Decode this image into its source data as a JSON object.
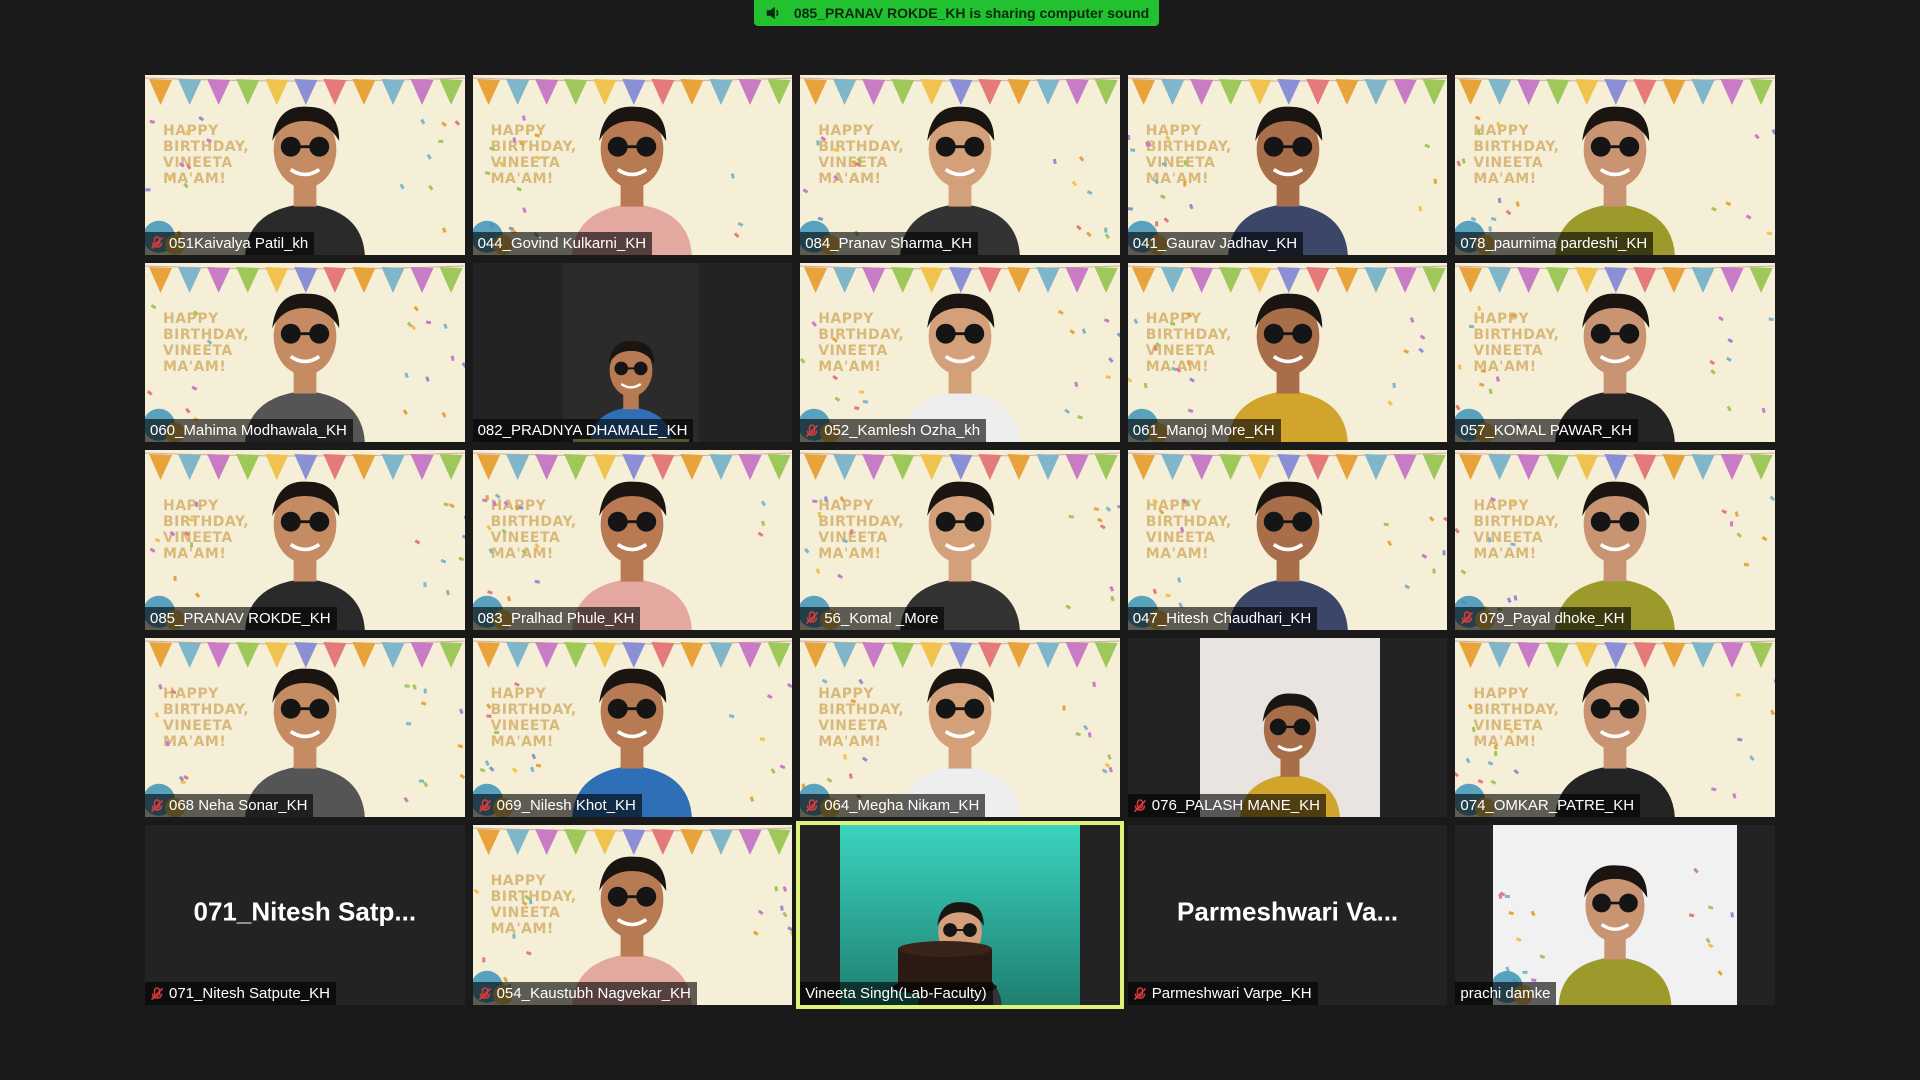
{
  "banner": {
    "text": "085_PRANAV ROKDE_KH is sharing computer sound",
    "icon": "speaker-icon",
    "color": "#22c12f"
  },
  "birthday_text": "HAPPY BIRTHDAY, VINEETA MA'AM!",
  "tiles": [
    {
      "name": "051Kaivalya Patil_kh",
      "muted": true,
      "bg": "birthday"
    },
    {
      "name": "044_Govind Kulkarni_KH",
      "muted": false,
      "bg": "birthday"
    },
    {
      "name": "084_Pranav Sharma_KH",
      "muted": false,
      "bg": "birthday"
    },
    {
      "name": "041_Gaurav Jadhav_KH",
      "muted": false,
      "bg": "birthday"
    },
    {
      "name": "078_paurnima pardeshi_KH",
      "muted": false,
      "bg": "birthday"
    },
    {
      "name": "060_Mahima Modhawala_KH",
      "muted": false,
      "bg": "birthday"
    },
    {
      "name": "082_PRADNYA DHAMALE_KH",
      "muted": false,
      "bg": "dark-video"
    },
    {
      "name": "052_Kamlesh Ozha_kh",
      "muted": true,
      "bg": "birthday"
    },
    {
      "name": "061_Manoj More_KH",
      "muted": false,
      "bg": "birthday"
    },
    {
      "name": "057_KOMAL PAWAR_KH",
      "muted": false,
      "bg": "birthday"
    },
    {
      "name": "085_PRANAV ROKDE_KH",
      "muted": false,
      "bg": "birthday"
    },
    {
      "name": "083_Pralhad Phule_KH",
      "muted": false,
      "bg": "birthday"
    },
    {
      "name": "56_Komal _More",
      "muted": true,
      "bg": "birthday"
    },
    {
      "name": "047_Hitesh Chaudhari_KH",
      "muted": false,
      "bg": "birthday"
    },
    {
      "name": "079_Payal dhoke_KH",
      "muted": true,
      "bg": "birthday"
    },
    {
      "name": "068 Neha Sonar_KH",
      "muted": true,
      "bg": "birthday"
    },
    {
      "name": "069_Nilesh Khot_KH",
      "muted": true,
      "bg": "birthday"
    },
    {
      "name": "064_Megha Nikam_KH",
      "muted": true,
      "bg": "birthday"
    },
    {
      "name": "076_PALASH MANE_KH",
      "muted": true,
      "bg": "camera"
    },
    {
      "name": "074_OMKAR_PATRE_KH",
      "muted": false,
      "bg": "birthday"
    },
    {
      "name": "071_Nitesh Satpute_KH",
      "muted": true,
      "bg": "off",
      "display": "071_Nitesh  Satp..."
    },
    {
      "name": "054_Kaustubh Nagvekar_KH",
      "muted": true,
      "bg": "birthday"
    },
    {
      "name": "Vineeta Singh(Lab-Faculty)",
      "muted": false,
      "bg": "cake",
      "active": true
    },
    {
      "name": "Parmeshwari Varpe_KH",
      "muted": true,
      "bg": "off",
      "display": "Parmeshwari  Va..."
    },
    {
      "name": "prachi damke",
      "muted": false,
      "bg": "prachi"
    }
  ]
}
